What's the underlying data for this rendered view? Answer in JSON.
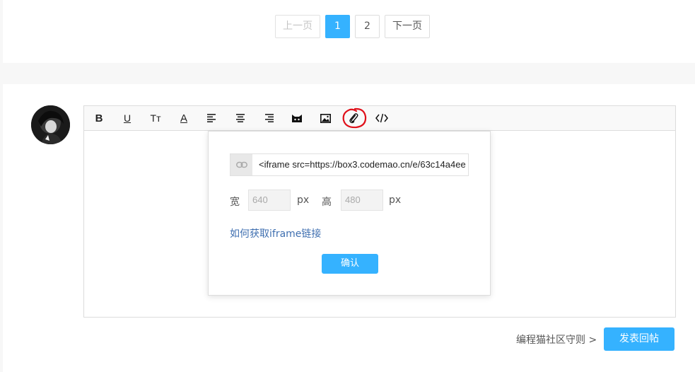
{
  "pagination": {
    "prev_label": "上一页",
    "pages": [
      "1",
      "2"
    ],
    "active_page": "1",
    "next_label": "下一页"
  },
  "toolbar": {
    "bold_icon": "B",
    "underline_icon": "U",
    "fontsize_icon": "Tт",
    "fontcolor_icon": "A",
    "buttons": [
      "bold-icon",
      "underline-icon",
      "font-size-icon",
      "font-color-icon",
      "align-left-icon",
      "align-center-icon",
      "align-right-icon",
      "cat-emoji-icon",
      "image-icon",
      "attachment-icon",
      "code-icon"
    ]
  },
  "embed_popup": {
    "url_value": "<iframe src=https://box3.codemao.cn/e/63c14a4ee",
    "width_label": "宽",
    "width_value": "640",
    "height_label": "高",
    "height_value": "480",
    "unit": "px",
    "help_link": "如何获取iframe链接",
    "confirm_label": "确认"
  },
  "footer": {
    "rules_link": "编程猫社区守则 >",
    "submit_label": "发表回帖"
  },
  "colors": {
    "accent": "#35b2ff",
    "link": "#3f6fb0",
    "annotation_red": "#e0101a"
  }
}
